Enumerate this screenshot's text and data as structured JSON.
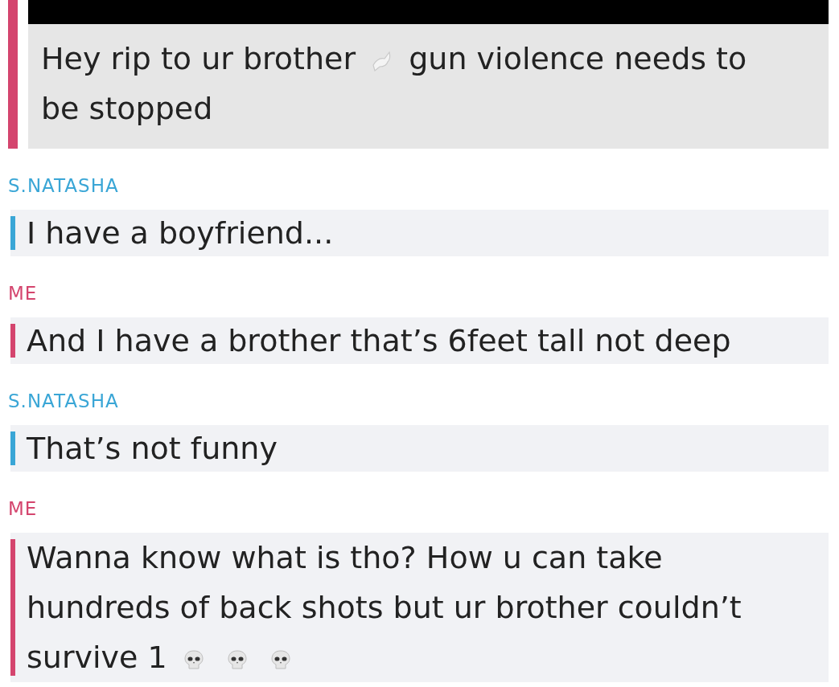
{
  "quoted_message": {
    "color": "#d4456e",
    "lines": [
      [
        {
          "kind": "text",
          "text": "Hey rip to ur brother"
        },
        {
          "kind": "dove"
        },
        {
          "kind": "text",
          "text": "gun violence needs to"
        }
      ],
      [
        {
          "kind": "text",
          "text": "be stopped"
        }
      ]
    ]
  },
  "messages": [
    {
      "sender": "S.NATASHA",
      "color": "#3aa6d6",
      "lines": [
        [
          {
            "kind": "text",
            "text": "I have a boyfriend..."
          }
        ]
      ]
    },
    {
      "sender": "ME",
      "color": "#d4456e",
      "lines": [
        [
          {
            "kind": "text",
            "text": "And I have a brother that’s 6feet tall not deep"
          }
        ]
      ]
    },
    {
      "sender": "S.NATASHA",
      "color": "#3aa6d6",
      "lines": [
        [
          {
            "kind": "text",
            "text": "That’s not funny"
          }
        ]
      ]
    },
    {
      "sender": "ME",
      "color": "#d4456e",
      "lines": [
        [
          {
            "kind": "text",
            "text": "Wanna know what is tho? How u can take"
          }
        ],
        [
          {
            "kind": "text",
            "text": "hundreds of back shots but ur brother couldn’t"
          }
        ],
        [
          {
            "kind": "text",
            "text": "survive 1"
          },
          {
            "kind": "skull"
          },
          {
            "kind": "skull"
          },
          {
            "kind": "skull"
          }
        ]
      ]
    }
  ]
}
